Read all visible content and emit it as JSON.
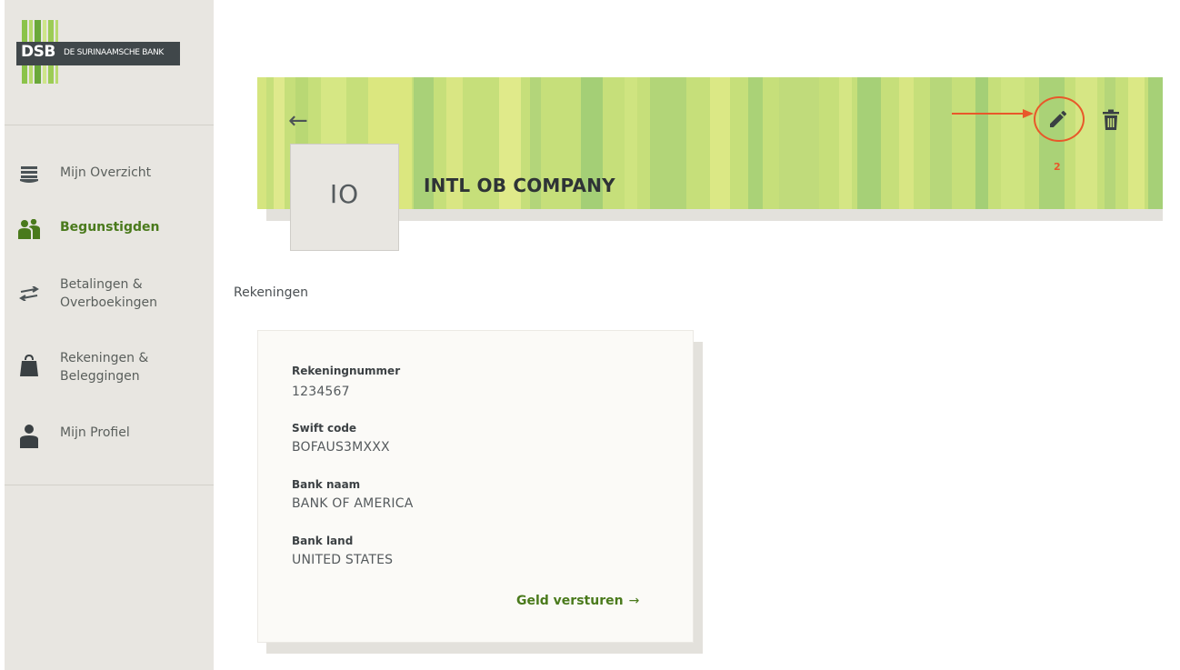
{
  "brand": {
    "logo_text": "DSB",
    "bank_name": "DE SURINAAMSCHE BANK"
  },
  "sidebar": {
    "items": [
      {
        "label_1": "Mijn Overzicht",
        "label_2": "",
        "icon": "overview-icon",
        "active": false
      },
      {
        "label_1": "Begunstigden",
        "label_2": "",
        "icon": "beneficiaries-icon",
        "active": true
      },
      {
        "label_1": "Betalingen &",
        "label_2": "Overboekingen",
        "icon": "transfer-arrows-icon",
        "active": false
      },
      {
        "label_1": "Rekeningen &",
        "label_2": "Beleggingen",
        "icon": "bag-icon",
        "active": false
      },
      {
        "label_1": "Mijn Profiel",
        "label_2": "",
        "icon": "profile-icon",
        "active": false
      }
    ]
  },
  "header": {
    "back_icon": "←",
    "avatar_initials": "IO",
    "company_name": "INTL OB COMPANY",
    "annotation_number": "2"
  },
  "section": {
    "title": "Rekeningen"
  },
  "account": {
    "fields": [
      {
        "label": "Rekeningnummer",
        "value": "1234567"
      },
      {
        "label": "Swift code",
        "value": "BOFAUS3MXXX"
      },
      {
        "label": "Bank naam",
        "value": "BANK OF AMERICA"
      },
      {
        "label": "Bank land",
        "value": "UNITED STATES"
      }
    ],
    "send_label": "Geld versturen",
    "send_arrow": "→"
  },
  "colors": {
    "accent_green": "#4a7a1c",
    "annotation": "#e8582a",
    "sidebar_bg": "#e8e6e1",
    "banner_green": "#c6df7a"
  }
}
